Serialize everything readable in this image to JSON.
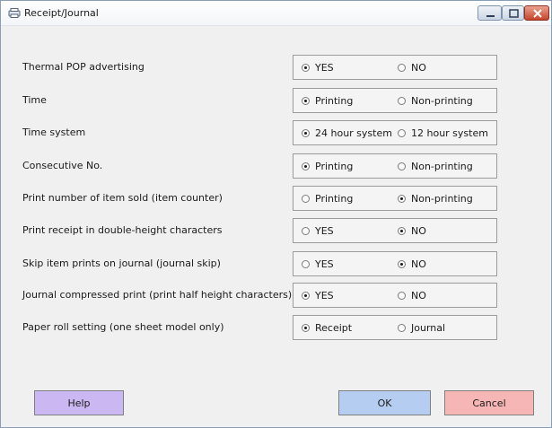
{
  "window": {
    "title": "Receipt/Journal"
  },
  "options": [
    {
      "label": "Thermal POP advertising",
      "choices": [
        "YES",
        "NO"
      ],
      "selected": 0
    },
    {
      "label": "Time",
      "choices": [
        "Printing",
        "Non-printing"
      ],
      "selected": 0
    },
    {
      "label": "Time system",
      "choices": [
        "24 hour system",
        "12 hour system"
      ],
      "selected": 0
    },
    {
      "label": "Consecutive No.",
      "choices": [
        "Printing",
        "Non-printing"
      ],
      "selected": 0
    },
    {
      "label": "Print number of item sold (item counter)",
      "choices": [
        "Printing",
        "Non-printing"
      ],
      "selected": 1
    },
    {
      "label": "Print receipt in double-height characters",
      "choices": [
        "YES",
        "NO"
      ],
      "selected": 1
    },
    {
      "label": "Skip item prints on journal (journal skip)",
      "choices": [
        "YES",
        "NO"
      ],
      "selected": 1
    },
    {
      "label": "Journal compressed print (print half height characters)",
      "choices": [
        "YES",
        "NO"
      ],
      "selected": 0
    },
    {
      "label": "Paper roll setting (one sheet model only)",
      "choices": [
        "Receipt",
        "Journal"
      ],
      "selected": 0
    }
  ],
  "buttons": {
    "help": "Help",
    "ok": "OK",
    "cancel": "Cancel"
  },
  "colors": {
    "help_button": "#cbb8f2",
    "ok_button": "#b6cdf2",
    "cancel_button": "#f5b6b5"
  },
  "icons": {
    "app": "receipt-printer-icon",
    "minimize": "minimize-icon",
    "maximize": "maximize-icon",
    "close": "close-icon"
  }
}
